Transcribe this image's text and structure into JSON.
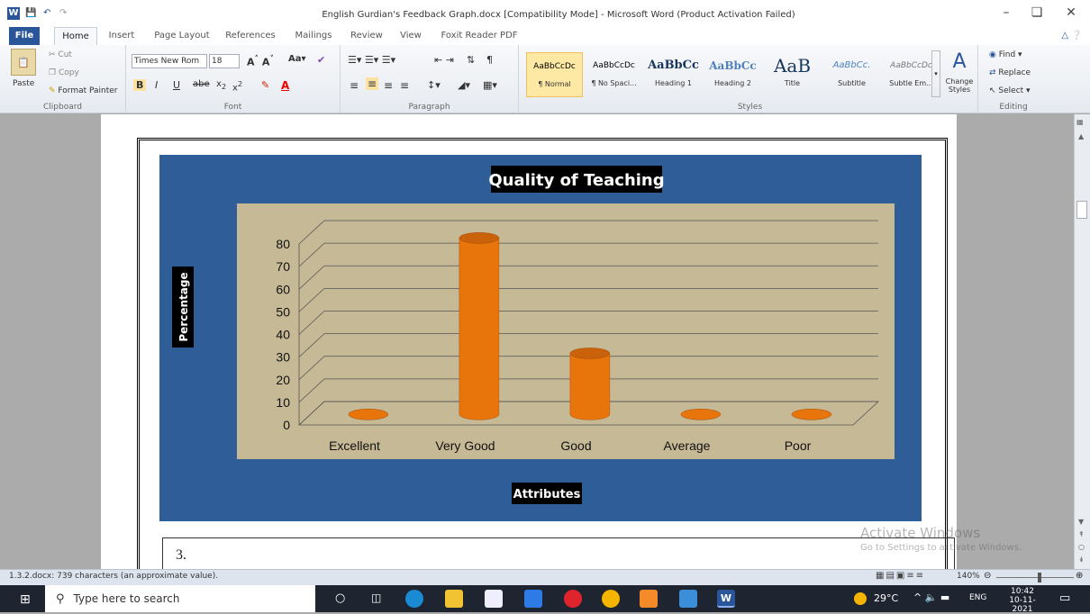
{
  "window": {
    "title": "English Gurdian's Feedback Graph.docx [Compatibility Mode] - Microsoft Word (Product Activation Failed)",
    "qa_icons": [
      "word-icon",
      "save-icon",
      "undo-icon",
      "redo-icon"
    ]
  },
  "tabs": [
    {
      "label": "File"
    },
    {
      "label": "Home"
    },
    {
      "label": "Insert"
    },
    {
      "label": "Page Layout"
    },
    {
      "label": "References"
    },
    {
      "label": "Mailings"
    },
    {
      "label": "Review"
    },
    {
      "label": "View"
    },
    {
      "label": "Foxit Reader PDF"
    }
  ],
  "ribbon": {
    "clipboard": {
      "label": "Clipboard",
      "paste": "Paste",
      "cut": "Cut",
      "copy": "Copy",
      "format_painter": "Format Painter"
    },
    "font": {
      "label": "Font",
      "family": "Times New Rom",
      "size": "18"
    },
    "paragraph": {
      "label": "Paragraph"
    },
    "styles": {
      "label": "Styles",
      "items": [
        {
          "sample": "AaBbCcDc",
          "name": "¶ Normal"
        },
        {
          "sample": "AaBbCcDc",
          "name": "¶ No Spaci..."
        },
        {
          "sample": "AaBbCc",
          "name": "Heading 1"
        },
        {
          "sample": "AaBbCc",
          "name": "Heading 2"
        },
        {
          "sample": "AaB",
          "name": "Title"
        },
        {
          "sample": "AaBbCc.",
          "name": "Subtitle"
        },
        {
          "sample": "AaBbCcDc",
          "name": "Subtle Em..."
        }
      ],
      "change_styles": "Change Styles"
    },
    "editing": {
      "label": "Editing",
      "find": "Find",
      "replace": "Replace",
      "select": "Select"
    }
  },
  "chart_data": {
    "type": "bar",
    "title": "Quality of Teaching",
    "xlabel": "Attributes",
    "ylabel": "Percentage",
    "categories": [
      "Excellent",
      "Very Good",
      "Good",
      "Average",
      "Poor"
    ],
    "values": [
      0,
      78,
      27,
      0,
      0
    ],
    "ylim": [
      0,
      80
    ],
    "yticks": [
      "0",
      "10",
      "20",
      "30",
      "40",
      "50",
      "60",
      "70",
      "80"
    ],
    "bar_color": "#e8740c",
    "plot_background": "#c6b996",
    "chart_background": "#2f5d97"
  },
  "document": {
    "next_item": "3."
  },
  "watermark": {
    "line1": "Activate Windows",
    "line2": "Go to Settings to activate Windows."
  },
  "statusbar": {
    "text": "1.3.2.docx: 739 characters (an approximate value).",
    "zoom": "140%"
  },
  "taskbar": {
    "search_placeholder": "Type here to search",
    "temperature": "29°C",
    "language": "ENG",
    "time": "10:42",
    "date": "10-11-2021"
  }
}
